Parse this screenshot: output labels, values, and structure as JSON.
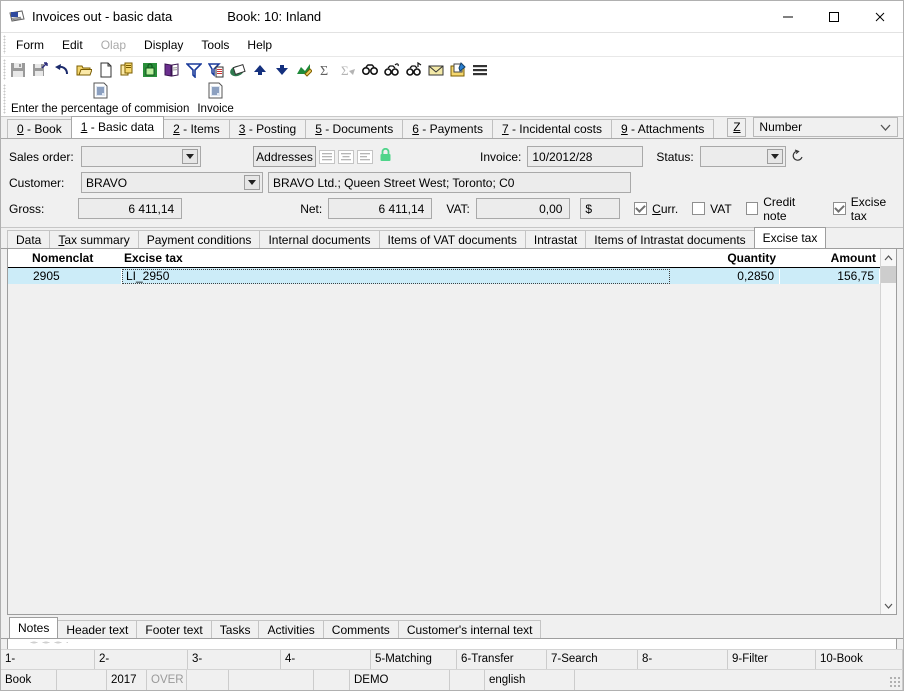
{
  "window": {
    "title": "Invoices out - basic data",
    "book": "Book: 10: Inland",
    "icon": "app-icon",
    "minimize": "—",
    "maximize": "☐",
    "close": "✕"
  },
  "menu": {
    "items": [
      {
        "label": "Form",
        "disabled": false
      },
      {
        "label": "Edit",
        "disabled": false
      },
      {
        "label": "Olap",
        "disabled": true
      },
      {
        "label": "Display",
        "disabled": false
      },
      {
        "label": "Tools",
        "disabled": false
      },
      {
        "label": "Help",
        "disabled": false
      }
    ]
  },
  "toolbar": {
    "icons": [
      "save-icon",
      "save-as-icon",
      "undo-icon",
      "open-folder-icon",
      "new-document-icon",
      "copy-icon",
      "lock-icon",
      "book-icon",
      "filter-icon",
      "filter-document-icon",
      "print-icon",
      "up-arrow-icon",
      "down-arrow-icon",
      "chart-edit-icon",
      "sum-icon",
      "sum-disabled-icon",
      "find-icon",
      "find-next-icon",
      "find-prev-icon",
      "mail-icon",
      "note-edit-icon",
      "menu-lines-icon"
    ]
  },
  "bigbar": {
    "buttons": [
      {
        "label": "Enter the percentage of commision",
        "icon": "document-icon"
      },
      {
        "label": "Invoice",
        "icon": "document-icon"
      }
    ]
  },
  "main_tabs": {
    "items": [
      {
        "accel": "0",
        "label": " - Book",
        "active": false
      },
      {
        "accel": "1",
        "label": " - Basic data",
        "active": true
      },
      {
        "accel": "2",
        "label": " - Items",
        "active": false
      },
      {
        "accel": "3",
        "label": " - Posting",
        "active": false
      },
      {
        "accel": "5",
        "label": " - Documents",
        "active": false
      },
      {
        "accel": "6",
        "label": " - Payments",
        "active": false
      },
      {
        "accel": "7",
        "label": " - Incidental costs",
        "active": false
      },
      {
        "accel": "9",
        "label": " - Attachments",
        "active": false
      }
    ],
    "z_button": "Z",
    "sort_combo": "Number",
    "search_field": "",
    "extra_field": ""
  },
  "form": {
    "sales_order_label": "Sales order:",
    "sales_order_value": "",
    "addresses_button": "Addresses",
    "invoice_label": "Invoice:",
    "invoice_value": "10/2012/28",
    "status_label": "Status:",
    "status_value": "",
    "customer_label": "Customer:",
    "customer_value": "BRAVO",
    "customer_address": "BRAVO Ltd.; Queen Street West; Toronto; C0",
    "gross_label": "Gross:",
    "gross_value": "6 411,14",
    "net_label": "Net:",
    "net_value": "6 411,14",
    "vat_label": "VAT:",
    "vat_value": "0,00",
    "currency_value": "$",
    "checkboxes": [
      {
        "label": "Curr.",
        "accel": "C",
        "checked": true
      },
      {
        "label": "VAT",
        "accel": "",
        "checked": false
      },
      {
        "label": "Credit note",
        "accel": "",
        "checked": false
      },
      {
        "label": "Excise tax",
        "accel": "",
        "checked": true
      }
    ]
  },
  "inner_tabs": {
    "items": [
      {
        "label": "Data",
        "active": false
      },
      {
        "label": "Tax summary",
        "active": false
      },
      {
        "label": "Payment conditions",
        "active": false
      },
      {
        "label": "Internal documents",
        "active": false
      },
      {
        "label": "Items of VAT documents",
        "active": false
      },
      {
        "label": "Intrastat",
        "active": false
      },
      {
        "label": "Items of Intrastat documents",
        "active": false
      },
      {
        "label": "Excise tax",
        "active": true
      }
    ]
  },
  "grid": {
    "columns": [
      "Nomenclat",
      "Excise tax",
      "Quantity",
      "Amount"
    ],
    "rows": [
      {
        "nomenclature": "2905",
        "excise_tax": "LI_2950",
        "quantity": "0,2850",
        "amount": "156,75",
        "selected": true
      }
    ]
  },
  "bottom_tabs": {
    "items": [
      {
        "label": "Notes",
        "active": true
      },
      {
        "label": "Header text",
        "active": false
      },
      {
        "label": "Footer text",
        "active": false
      },
      {
        "label": "Tasks",
        "active": false
      },
      {
        "label": "Activities",
        "active": false
      },
      {
        "label": "Comments",
        "active": false
      },
      {
        "label": "Customer's internal text",
        "active": false
      }
    ]
  },
  "function_keys": [
    {
      "label": "1-"
    },
    {
      "label": "2-"
    },
    {
      "label": "3-"
    },
    {
      "label": "4-"
    },
    {
      "label": "5-Matching"
    },
    {
      "label": "6-Transfer"
    },
    {
      "label": "7-Search"
    },
    {
      "label": "8-"
    },
    {
      "label": "9-Filter"
    },
    {
      "label": "10-Book"
    }
  ],
  "status_cells": [
    {
      "label": "Book",
      "dim": false
    },
    {
      "label": "",
      "dim": false
    },
    {
      "label": "2017",
      "dim": false
    },
    {
      "label": "OVER",
      "dim": true
    },
    {
      "label": "",
      "dim": false
    },
    {
      "label": "",
      "dim": false
    },
    {
      "label": "",
      "dim": false
    },
    {
      "label": "DEMO",
      "dim": false
    },
    {
      "label": "",
      "dim": false
    },
    {
      "label": "english",
      "dim": false
    },
    {
      "label": "",
      "dim": false
    }
  ],
  "colors": {
    "selection": "#ccecf8",
    "yellow_field": "#ffffe1",
    "window_bg": "#f0f0f0",
    "lock_green": "#4fd48a"
  }
}
